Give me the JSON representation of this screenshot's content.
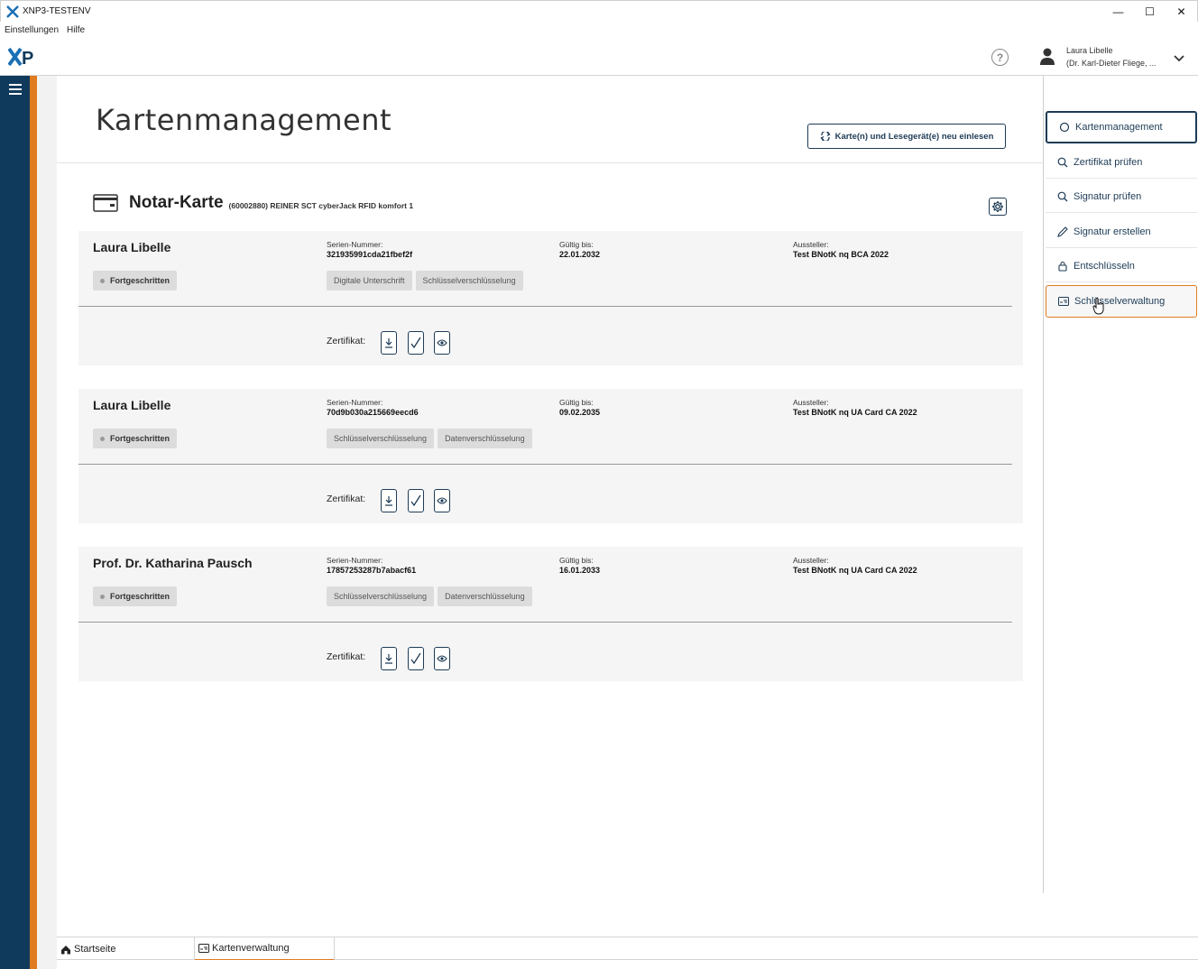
{
  "window": {
    "title": "XNP3-TESTENV",
    "minimize_glyph": "—",
    "maximize_glyph": "☐",
    "close_glyph": "✕"
  },
  "menu": {
    "items": [
      "Einstellungen",
      "Hilfe"
    ]
  },
  "header": {
    "logo_text": "XP",
    "help_glyph": "?",
    "user_name": "Laura Libelle",
    "user_org": "(Dr. Karl-Dieter Fliege, ..."
  },
  "main": {
    "page_title": "Kartenmanagement",
    "reload_button": "Karte(n) und Lesegerät(e) neu einlesen",
    "card": {
      "title": "Notar-Karte",
      "subtitle": "(60002880) REINER SCT cyberJack RFID komfort 1"
    },
    "labels": {
      "serial": "Serien-Nummer:",
      "valid_until": "Gültig bis:",
      "issuer": "Aussteller:",
      "certificate": "Zertifikat:"
    },
    "certificates": [
      {
        "name": "Laura Libelle",
        "level": "Fortgeschritten",
        "serial": "321935991cda21fbef2f",
        "valid_until": "22.01.2032",
        "issuer": "Test BNotK nq BCA 2022",
        "usages": [
          "Digitale Unterschrift",
          "Schlüsselverschlüsselung"
        ]
      },
      {
        "name": "Laura Libelle",
        "level": "Fortgeschritten",
        "serial": "70d9b030a215669eecd6",
        "valid_until": "09.02.2035",
        "issuer": "Test BNotK nq UA Card CA 2022",
        "usages": [
          "Schlüsselverschlüsselung",
          "Datenverschlüsselung"
        ]
      },
      {
        "name": "Prof. Dr. Katharina Pausch",
        "level": "Fortgeschritten",
        "serial": "17857253287b7abacf61",
        "valid_until": "16.01.2033",
        "issuer": "Test BNotK nq UA Card CA 2022",
        "usages": [
          "Schlüsselverschlüsselung",
          "Datenverschlüsselung"
        ]
      }
    ]
  },
  "sidebar": {
    "items": [
      {
        "label": "Kartenmanagement",
        "icon": "refresh-circle-icon",
        "state": "active"
      },
      {
        "label": "Zertifikat prüfen",
        "icon": "search-icon",
        "state": "normal"
      },
      {
        "label": "Signatur prüfen",
        "icon": "search-icon",
        "state": "normal"
      },
      {
        "label": "Signatur erstellen",
        "icon": "pen-icon",
        "state": "normal"
      },
      {
        "label": "Entschlüsseln",
        "icon": "lock-icon",
        "state": "normal"
      },
      {
        "label": "Schlüsselverwaltung",
        "icon": "key-card-icon",
        "state": "hover"
      }
    ]
  },
  "bottom_tabs": [
    {
      "label": "Startseite",
      "icon": "home-icon",
      "active": false
    },
    {
      "label": "Kartenverwaltung",
      "icon": "card-icon",
      "active": true
    }
  ],
  "colors": {
    "navy": "#0f3a5c",
    "accent_orange": "#e07b1f",
    "button_border": "#1d3b56"
  }
}
